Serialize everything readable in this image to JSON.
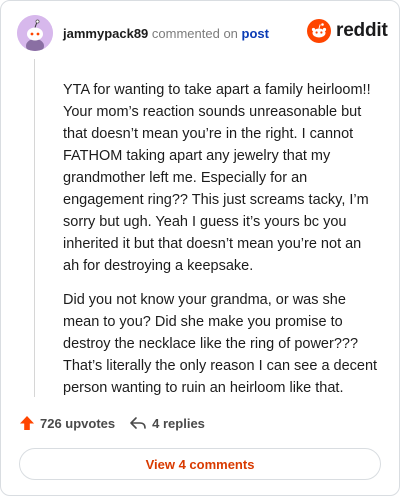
{
  "comment": {
    "username": "jammypack89",
    "commented_on_text": "commented on",
    "post_link_text": "post",
    "paragraphs": [
      "YTA for wanting to take apart a family heirloom!! Your mom’s reaction sounds unreasonable but that doesn’t mean you’re in the right. I cannot FATHOM taking apart any jewelry that my grandmother left me. Especially for an engagement ring?? This just screams tacky, I’m sorry but ugh. Yeah I guess it’s yours bc you inherited it but that doesn’t mean you’re not an ah for destroying a keepsake.",
      "Did you not know your grandma, or was she mean to you? Did she make you promise to destroy the necklace like the ring of power??? That’s literally the only reason I can see a decent person wanting to ruin an heirloom like that."
    ]
  },
  "brand": {
    "name": "reddit",
    "color": "#ff4500"
  },
  "actions": {
    "upvotes": "726 upvotes",
    "replies": "4 replies"
  },
  "view_comments_label": "View 4 comments",
  "colors": {
    "accent": "#d93a00",
    "upvote": "#ff4500",
    "link": "#0a3bb5"
  }
}
